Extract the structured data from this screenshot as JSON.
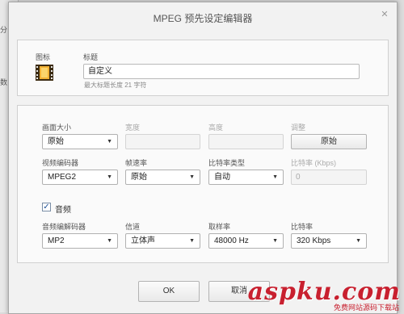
{
  "window": {
    "title": "MPEG 预先设定编辑器"
  },
  "background": {
    "frag1": "数",
    "frag2": "分"
  },
  "header": {
    "icon_label": "图标",
    "title_label": "标题",
    "title_value": "自定义",
    "title_hint": "最大标题长度 21 字符"
  },
  "video": {
    "frame_size_label": "画面大小",
    "frame_size_value": "原始",
    "width_label": "宽度",
    "height_label": "高度",
    "adjust_label": "调整",
    "adjust_button": "原始",
    "codec_label": "视频编码器",
    "codec_value": "MPEG2",
    "frame_rate_label": "帧速率",
    "frame_rate_value": "原始",
    "bitrate_type_label": "比特率类型",
    "bitrate_type_value": "自动",
    "bitrate_label": "比特率 (Kbps)",
    "bitrate_value": "0"
  },
  "audio": {
    "enabled_label": "音频",
    "enabled": true,
    "codec_label": "音频编解码器",
    "codec_value": "MP2",
    "channels_label": "信道",
    "channels_value": "立体声",
    "sample_rate_label": "取样率",
    "sample_rate_value": "48000 Hz",
    "bitrate_label": "比特率",
    "bitrate_value": "320 Kbps"
  },
  "footer": {
    "ok": "OK",
    "cancel": "取消"
  },
  "watermark": {
    "main": "aspku.com",
    "sub": "免费网站源码下载站"
  },
  "colors": {
    "accent": "#1c4f96",
    "watermark": "#c8202f"
  }
}
